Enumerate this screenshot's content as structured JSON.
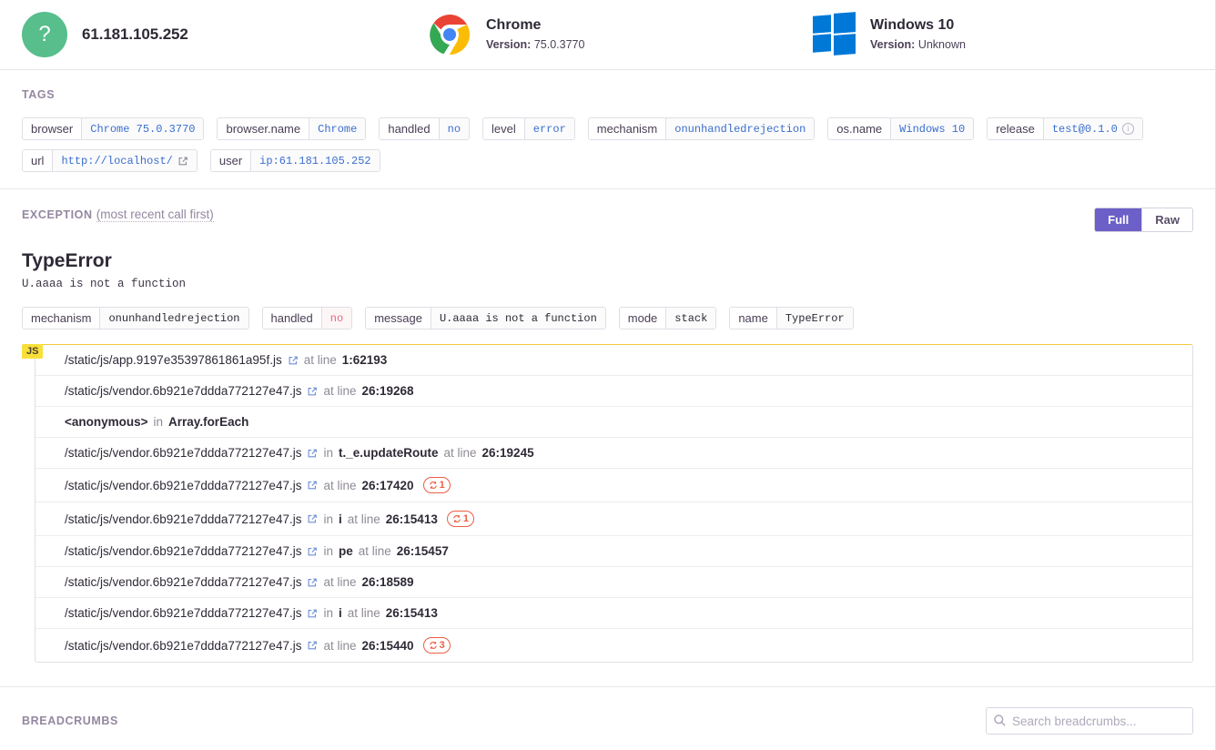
{
  "context_header": {
    "items": [
      {
        "icon": "user-question-avatar",
        "title": "61.181.105.252",
        "version_label": "",
        "version_value": ""
      },
      {
        "icon": "chrome-logo",
        "title": "Chrome",
        "version_label": "Version:",
        "version_value": "75.0.3770"
      },
      {
        "icon": "windows-logo",
        "title": "Windows 10",
        "version_label": "Version:",
        "version_value": "Unknown"
      }
    ]
  },
  "tags_section": {
    "title": "TAGS",
    "tags": [
      {
        "key": "browser",
        "value": "Chrome 75.0.3770",
        "style": "link"
      },
      {
        "key": "browser.name",
        "value": "Chrome",
        "style": "link"
      },
      {
        "key": "handled",
        "value": "no",
        "style": "link"
      },
      {
        "key": "level",
        "value": "error",
        "style": "link"
      },
      {
        "key": "mechanism",
        "value": "onunhandledrejection",
        "style": "link"
      },
      {
        "key": "os.name",
        "value": "Windows 10",
        "style": "link"
      },
      {
        "key": "release",
        "value": "test@0.1.0",
        "style": "link",
        "icon": "info-icon"
      },
      {
        "key": "url",
        "value": "http://localhost/",
        "style": "link",
        "icon": "external-link-icon"
      },
      {
        "key": "user",
        "value": "ip:61.181.105.252",
        "style": "link"
      }
    ]
  },
  "exception_section": {
    "title": "EXCEPTION",
    "subtitle": "(most recent call first)",
    "toggle": {
      "full_label": "Full",
      "raw_label": "Raw",
      "active": "Full"
    },
    "error_type": "TypeError",
    "error_value": "U.aaaa is not a function",
    "meta_tags": [
      {
        "key": "mechanism",
        "value": "onunhandledrejection",
        "style": "dark"
      },
      {
        "key": "handled",
        "value": "no",
        "style": "error"
      },
      {
        "key": "message",
        "value": "U.aaaa is not a function",
        "style": "dark"
      },
      {
        "key": "mode",
        "value": "stack",
        "style": "dark"
      },
      {
        "key": "name",
        "value": "TypeError",
        "style": "dark"
      }
    ],
    "platform_badge": "JS",
    "frames": [
      {
        "filename": "/static/js/app.9197e35397861861a95f.js",
        "has_link": true,
        "in_label": "",
        "function": "",
        "at_label": "at line",
        "lineno": "1:62193",
        "repeat": ""
      },
      {
        "filename": "/static/js/vendor.6b921e7ddda772127e47.js",
        "has_link": true,
        "in_label": "",
        "function": "",
        "at_label": "at line",
        "lineno": "26:19268",
        "repeat": ""
      },
      {
        "filename": "<anonymous>",
        "has_link": false,
        "in_label": "in",
        "function": "Array.forEach",
        "at_label": "",
        "lineno": "",
        "repeat": ""
      },
      {
        "filename": "/static/js/vendor.6b921e7ddda772127e47.js",
        "has_link": true,
        "in_label": "in",
        "function": "t._e.updateRoute",
        "at_label": "at line",
        "lineno": "26:19245",
        "repeat": ""
      },
      {
        "filename": "/static/js/vendor.6b921e7ddda772127e47.js",
        "has_link": true,
        "in_label": "",
        "function": "",
        "at_label": "at line",
        "lineno": "26:17420",
        "repeat": "1"
      },
      {
        "filename": "/static/js/vendor.6b921e7ddda772127e47.js",
        "has_link": true,
        "in_label": "in",
        "function": "i",
        "at_label": "at line",
        "lineno": "26:15413",
        "repeat": "1"
      },
      {
        "filename": "/static/js/vendor.6b921e7ddda772127e47.js",
        "has_link": true,
        "in_label": "in",
        "function": "pe",
        "at_label": "at line",
        "lineno": "26:15457",
        "repeat": ""
      },
      {
        "filename": "/static/js/vendor.6b921e7ddda772127e47.js",
        "has_link": true,
        "in_label": "",
        "function": "",
        "at_label": "at line",
        "lineno": "26:18589",
        "repeat": ""
      },
      {
        "filename": "/static/js/vendor.6b921e7ddda772127e47.js",
        "has_link": true,
        "in_label": "in",
        "function": "i",
        "at_label": "at line",
        "lineno": "26:15413",
        "repeat": ""
      },
      {
        "filename": "/static/js/vendor.6b921e7ddda772127e47.js",
        "has_link": true,
        "in_label": "",
        "function": "",
        "at_label": "at line",
        "lineno": "26:15440",
        "repeat": "3"
      }
    ]
  },
  "breadcrumbs_section": {
    "title": "BREADCRUMBS",
    "search_placeholder": "Search breadcrumbs...",
    "search_value": ""
  },
  "colors": {
    "accent_purple": "#6c5fc7",
    "avatar_green": "#57be8c",
    "badge_yellow": "#f8df3a",
    "repeat_orange": "#ec5e44",
    "link_blue": "#3b6ecc",
    "muted": "#9487a0"
  }
}
